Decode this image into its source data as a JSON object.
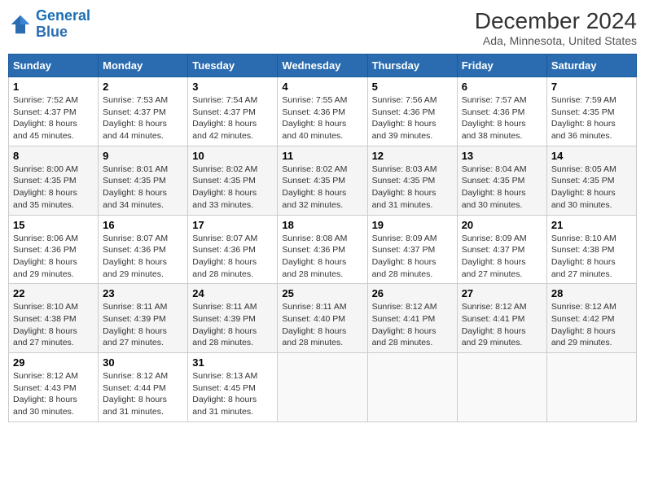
{
  "logo": {
    "line1": "General",
    "line2": "Blue"
  },
  "title": "December 2024",
  "subtitle": "Ada, Minnesota, United States",
  "days_of_week": [
    "Sunday",
    "Monday",
    "Tuesday",
    "Wednesday",
    "Thursday",
    "Friday",
    "Saturday"
  ],
  "weeks": [
    [
      {
        "day": "1",
        "sunrise": "7:52 AM",
        "sunset": "4:37 PM",
        "daylight": "8 hours and 45 minutes."
      },
      {
        "day": "2",
        "sunrise": "7:53 AM",
        "sunset": "4:37 PM",
        "daylight": "8 hours and 44 minutes."
      },
      {
        "day": "3",
        "sunrise": "7:54 AM",
        "sunset": "4:37 PM",
        "daylight": "8 hours and 42 minutes."
      },
      {
        "day": "4",
        "sunrise": "7:55 AM",
        "sunset": "4:36 PM",
        "daylight": "8 hours and 40 minutes."
      },
      {
        "day": "5",
        "sunrise": "7:56 AM",
        "sunset": "4:36 PM",
        "daylight": "8 hours and 39 minutes."
      },
      {
        "day": "6",
        "sunrise": "7:57 AM",
        "sunset": "4:36 PM",
        "daylight": "8 hours and 38 minutes."
      },
      {
        "day": "7",
        "sunrise": "7:59 AM",
        "sunset": "4:35 PM",
        "daylight": "8 hours and 36 minutes."
      }
    ],
    [
      {
        "day": "8",
        "sunrise": "8:00 AM",
        "sunset": "4:35 PM",
        "daylight": "8 hours and 35 minutes."
      },
      {
        "day": "9",
        "sunrise": "8:01 AM",
        "sunset": "4:35 PM",
        "daylight": "8 hours and 34 minutes."
      },
      {
        "day": "10",
        "sunrise": "8:02 AM",
        "sunset": "4:35 PM",
        "daylight": "8 hours and 33 minutes."
      },
      {
        "day": "11",
        "sunrise": "8:02 AM",
        "sunset": "4:35 PM",
        "daylight": "8 hours and 32 minutes."
      },
      {
        "day": "12",
        "sunrise": "8:03 AM",
        "sunset": "4:35 PM",
        "daylight": "8 hours and 31 minutes."
      },
      {
        "day": "13",
        "sunrise": "8:04 AM",
        "sunset": "4:35 PM",
        "daylight": "8 hours and 30 minutes."
      },
      {
        "day": "14",
        "sunrise": "8:05 AM",
        "sunset": "4:35 PM",
        "daylight": "8 hours and 30 minutes."
      }
    ],
    [
      {
        "day": "15",
        "sunrise": "8:06 AM",
        "sunset": "4:36 PM",
        "daylight": "8 hours and 29 minutes."
      },
      {
        "day": "16",
        "sunrise": "8:07 AM",
        "sunset": "4:36 PM",
        "daylight": "8 hours and 29 minutes."
      },
      {
        "day": "17",
        "sunrise": "8:07 AM",
        "sunset": "4:36 PM",
        "daylight": "8 hours and 28 minutes."
      },
      {
        "day": "18",
        "sunrise": "8:08 AM",
        "sunset": "4:36 PM",
        "daylight": "8 hours and 28 minutes."
      },
      {
        "day": "19",
        "sunrise": "8:09 AM",
        "sunset": "4:37 PM",
        "daylight": "8 hours and 28 minutes."
      },
      {
        "day": "20",
        "sunrise": "8:09 AM",
        "sunset": "4:37 PM",
        "daylight": "8 hours and 27 minutes."
      },
      {
        "day": "21",
        "sunrise": "8:10 AM",
        "sunset": "4:38 PM",
        "daylight": "8 hours and 27 minutes."
      }
    ],
    [
      {
        "day": "22",
        "sunrise": "8:10 AM",
        "sunset": "4:38 PM",
        "daylight": "8 hours and 27 minutes."
      },
      {
        "day": "23",
        "sunrise": "8:11 AM",
        "sunset": "4:39 PM",
        "daylight": "8 hours and 27 minutes."
      },
      {
        "day": "24",
        "sunrise": "8:11 AM",
        "sunset": "4:39 PM",
        "daylight": "8 hours and 28 minutes."
      },
      {
        "day": "25",
        "sunrise": "8:11 AM",
        "sunset": "4:40 PM",
        "daylight": "8 hours and 28 minutes."
      },
      {
        "day": "26",
        "sunrise": "8:12 AM",
        "sunset": "4:41 PM",
        "daylight": "8 hours and 28 minutes."
      },
      {
        "day": "27",
        "sunrise": "8:12 AM",
        "sunset": "4:41 PM",
        "daylight": "8 hours and 29 minutes."
      },
      {
        "day": "28",
        "sunrise": "8:12 AM",
        "sunset": "4:42 PM",
        "daylight": "8 hours and 29 minutes."
      }
    ],
    [
      {
        "day": "29",
        "sunrise": "8:12 AM",
        "sunset": "4:43 PM",
        "daylight": "8 hours and 30 minutes."
      },
      {
        "day": "30",
        "sunrise": "8:12 AM",
        "sunset": "4:44 PM",
        "daylight": "8 hours and 31 minutes."
      },
      {
        "day": "31",
        "sunrise": "8:13 AM",
        "sunset": "4:45 PM",
        "daylight": "8 hours and 31 minutes."
      },
      null,
      null,
      null,
      null
    ]
  ]
}
